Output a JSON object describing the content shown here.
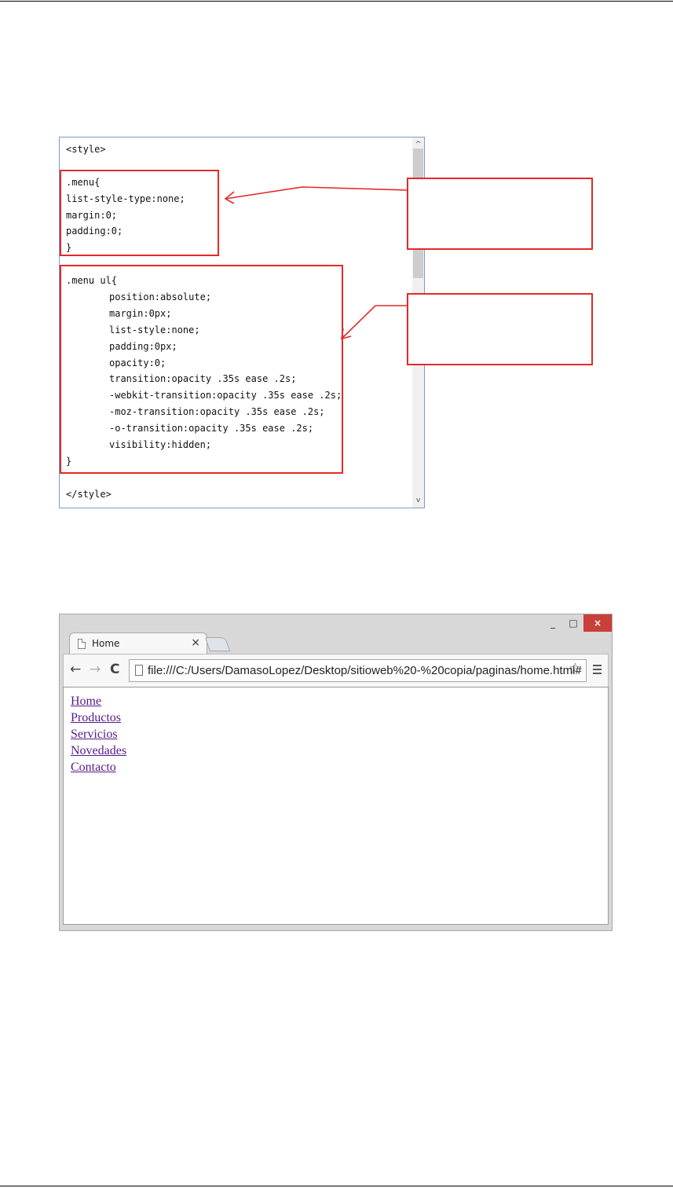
{
  "code_editor": {
    "lines": [
      "<style>",
      "",
      ".menu{",
      "list-style-type:none;",
      "margin:0;",
      "padding:0;",
      "}",
      "",
      ".menu ul{",
      "position:absolute;",
      "margin:0px;",
      "list-style:none;",
      "padding:0px;",
      "opacity:0;",
      "transition:opacity .35s ease .2s;",
      "-webkit-transition:opacity .35s ease .2s;",
      "-moz-transition:opacity .35s ease .2s;",
      "-o-transition:opacity .35s ease .2s;",
      "visibility:hidden;",
      "}",
      "",
      "</style>"
    ],
    "scroll_up_glyph": "^",
    "scroll_down_glyph": "v"
  },
  "annotation_color": "#e32a2a",
  "browser": {
    "window_controls": {
      "minimize": "_",
      "maximize": "□",
      "close": "×"
    },
    "tab": {
      "title": "Home",
      "close": "×"
    },
    "nav": {
      "back": "←",
      "forward": "→",
      "reload": "C"
    },
    "address_bar": {
      "url": "file:///C:/Users/DamasoLopez/Desktop/sitioweb%20-%20copia/paginas/home.html#"
    },
    "star_icon": "☆",
    "page_links": [
      "Home",
      "Productos",
      "Servicios",
      "Novedades",
      "Contacto"
    ],
    "link_color": "#551a8b"
  }
}
